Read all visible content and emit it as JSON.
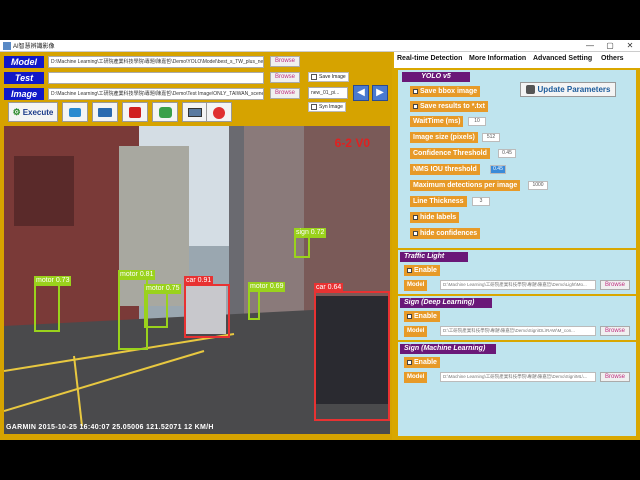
{
  "window": {
    "title": "AI智慧辨識影像",
    "controls": [
      "—",
      "▢",
      "✕"
    ]
  },
  "rows": {
    "model": {
      "label": "Model",
      "path": "D:\\Machine Learning\\工研院產業科技學院\\專題\\陳嘉哲\\Demo\\YOLO\\Model\\best_s_TW_plus_new...",
      "browse": "Browse"
    },
    "test": {
      "label": "Test",
      "path": "",
      "browse": "Browse",
      "checkbox": "Save Image"
    },
    "image": {
      "label": "Image",
      "path": "D:\\Machine Learning\\工研院產業科技學院\\專題\\陳嘉哲\\Demo\\Test Image\\ONLY_TAIWAN_scene",
      "browse": "Browse",
      "select": "new_01_pi...",
      "checkbox": "Syn Image"
    }
  },
  "toolbar": {
    "execute": "Execute",
    "icons": [
      "camera-icon",
      "video-camera-icon",
      "youtube-icon",
      "gallery-icon",
      "recycle-icon",
      "monitor-icon",
      "stop-icon"
    ]
  },
  "video": {
    "plate": "6-2 V0",
    "osd": "GARMIN   2015-10-25  16:40:07    25.05006 121.52071    12 KM/H",
    "detections": [
      {
        "label": "motor 0.73",
        "color": "#9ad21c"
      },
      {
        "label": "motor 0.81",
        "color": "#9ad21c"
      },
      {
        "label": "motor 0.75",
        "color": "#9ad21c"
      },
      {
        "label": "car 0.91",
        "color": "#e83232"
      },
      {
        "label": "motor 0.69",
        "color": "#9ad21c"
      },
      {
        "label": "sign 0.72",
        "color": "#9ad21c"
      },
      {
        "label": "car 0.64",
        "color": "#e83232"
      }
    ]
  },
  "tabs": [
    "Real-time Detection",
    "More Information",
    "Advanced Setting",
    "Others"
  ],
  "yolo": {
    "title": "YOLO v5",
    "update_button": "Update Parameters",
    "save_bbox": "Save bbox image",
    "save_results": "Save results to *.txt",
    "params": [
      {
        "label": "WaitTime (ms)",
        "value": "10"
      },
      {
        "label": "Image size (pixels)",
        "value": "512"
      },
      {
        "label": "Confidence Threshold",
        "value": "0.45"
      },
      {
        "label": "NMS IOU threshold",
        "value": "0.45"
      },
      {
        "label": "Maximum detections per image",
        "value": "1000"
      },
      {
        "label": "Line Thickness",
        "value": "3"
      }
    ],
    "hide_labels": "hide labels",
    "hide_conf": "hide confidences"
  },
  "traffic_light": {
    "title": "Traffic Light",
    "enable": "Enable",
    "model_label": "Model",
    "path": "D:\\Machine Learning\\工研院產業科技學院\\專題\\陳嘉哲\\Demo\\Light\\Mo...",
    "browse": "Browse"
  },
  "sign_dl": {
    "title": "Sign (Deep Learning)",
    "enable": "Enable",
    "model_label": "Model",
    "path": "D:\\工研院產業科技學院\\專題\\陳嘉哲\\Demo\\Sign\\DL\\RAW\\M_con...",
    "browse": "Browse"
  },
  "sign_ml": {
    "title": "Sign (Machine Learning)",
    "enable": "Enable",
    "model_label": "Model",
    "path": "D:\\Machine Learning\\工研院產業科技學院\\專題\\陳嘉哲\\Demo\\Sign\\ML\\...",
    "browse": "Browse"
  }
}
